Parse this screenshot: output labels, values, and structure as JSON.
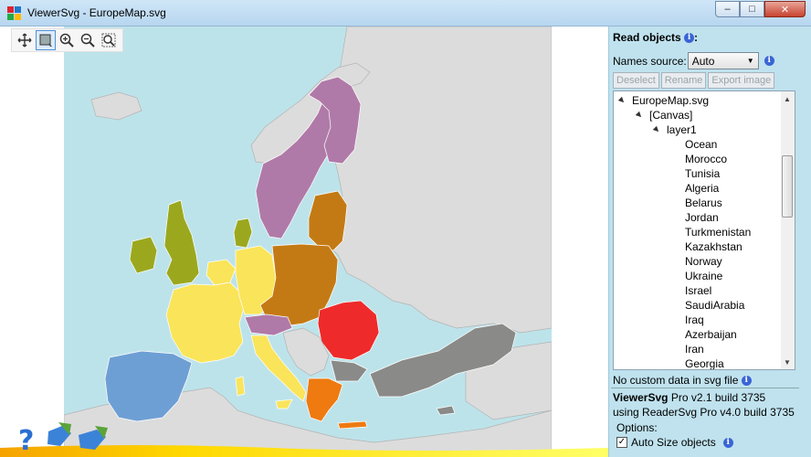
{
  "window": {
    "title": "ViewerSvg - EuropeMap.svg",
    "minimize": "–",
    "maximize": "□",
    "close": "✕"
  },
  "colors": {
    "ocean": "#bde3ea",
    "land": "#dcdcdc",
    "border": "#b3b3b3",
    "nordic": "#b07aa8",
    "british": "#9ba81e",
    "france": "#fae45a",
    "iberia": "#6e9fd4",
    "central": "#c47a14",
    "romania": "#ef2a2a",
    "greece": "#ee7a10",
    "turkey": "#8a8a88"
  },
  "toolbar": [
    "pan-icon",
    "select-icon",
    "zoom-in-icon",
    "zoom-out-icon",
    "zoom-fit-icon"
  ],
  "panel": {
    "read_objects": "Read objects",
    "colon": ":",
    "names_source_label": "Names source:",
    "names_source_value": "Auto",
    "buttons": {
      "deselect": "Deselect",
      "rename": "Rename",
      "export": "Export image"
    },
    "tree": {
      "root": "EuropeMap.svg",
      "canvas": "[Canvas]",
      "layer": "layer1",
      "items": [
        "Ocean",
        "Morocco",
        "Tunisia",
        "Algeria",
        "Belarus",
        "Jordan",
        "Turkmenistan",
        "Kazakhstan",
        "Norway",
        "Ukraine",
        "Israel",
        "SaudiArabia",
        "Iraq",
        "Azerbaijan",
        "Iran",
        "Georgia"
      ]
    },
    "status": "No custom data in svg file",
    "version_name": "ViewerSvg",
    "version_rest": " Pro v2.1 build 3735",
    "reader_line": "using ReaderSvg Pro v4.0 build 3735",
    "options_label": "Options:",
    "auto_size_label": "Auto Size objects",
    "auto_size_checked": "✓"
  }
}
